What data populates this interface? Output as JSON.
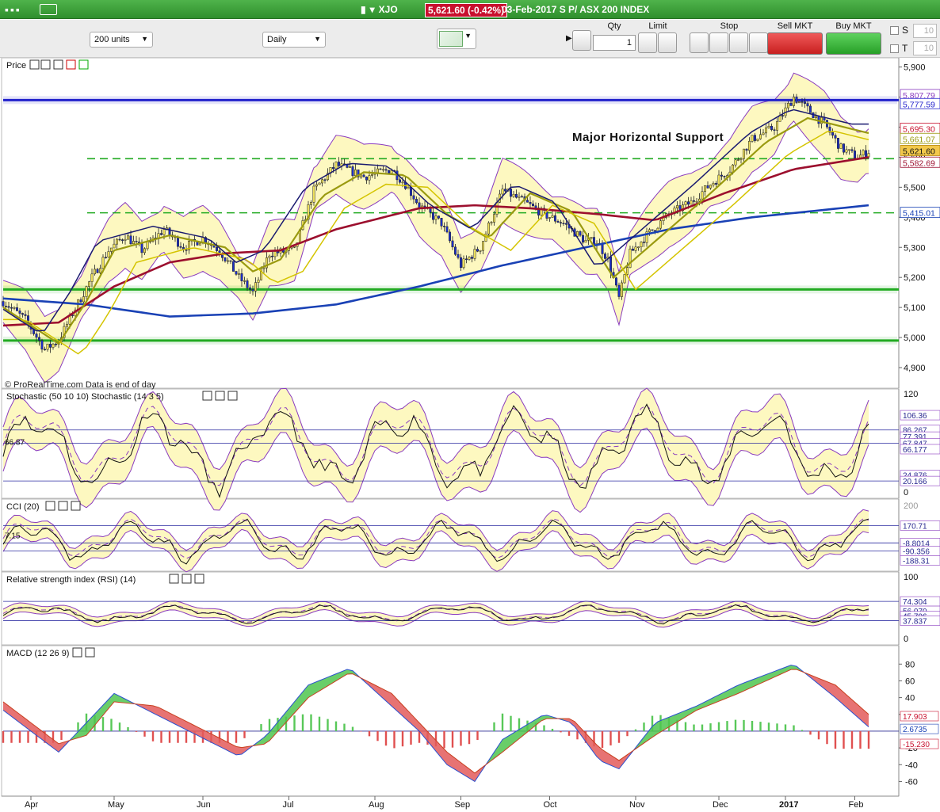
{
  "window": {
    "symbol": "XJO",
    "price_change": "5,621.60 (-0.42%)",
    "info": "03-Feb-2017 S P/ ASX 200 INDEX"
  },
  "toolbar": {
    "units_select": "200 units",
    "period_select": "Daily",
    "qty_label": "Qty",
    "qty_value": "1",
    "limit_label": "Limit",
    "stop_label": "Stop",
    "sell_label": "Sell MKT",
    "buy_label": "Buy MKT",
    "s_label": "S",
    "t_label": "T",
    "s_value": "10",
    "t_value": "10"
  },
  "colors": {
    "band_fill": "#fdf8c0",
    "band_line": "#8a3bbf",
    "up_candle": "#f2e35c",
    "down_candle": "#1c2fc9",
    "ma_olive": "#9a9a10",
    "ma_red": "#9c0f2e",
    "ma_blue": "#1941b5",
    "support_green": "#22aa22",
    "resistance_blue": "#2222cc"
  },
  "chart_data": [
    {
      "type": "candlestick",
      "panel": "Price",
      "title": "Price",
      "watermark": "© ProRealTime.com  Data is end of day",
      "annotation": "Major Horizontal Support",
      "ylim": [
        4850,
        5920
      ],
      "yticks": [
        "5,900",
        "5,800",
        "5,700",
        "5,600",
        "5,500",
        "5,400",
        "5,300",
        "5,200",
        "5,100",
        "5,000",
        "4,900"
      ],
      "x_labels": [
        "Apr",
        "May",
        "Jun",
        "Jul",
        "Aug",
        "Sep",
        "Oct",
        "Nov",
        "Dec",
        "2017",
        "Feb"
      ],
      "close_path": [
        [
          0,
          5120
        ],
        [
          8,
          5060
        ],
        [
          15,
          4960
        ],
        [
          20,
          4990
        ],
        [
          25,
          5080
        ],
        [
          32,
          5200
        ],
        [
          38,
          5290
        ],
        [
          44,
          5340
        ],
        [
          50,
          5290
        ],
        [
          58,
          5360
        ],
        [
          65,
          5300
        ],
        [
          72,
          5330
        ],
        [
          78,
          5290
        ],
        [
          85,
          5200
        ],
        [
          90,
          5150
        ],
        [
          96,
          5280
        ],
        [
          105,
          5290
        ],
        [
          112,
          5490
        ],
        [
          120,
          5575
        ],
        [
          130,
          5535
        ],
        [
          140,
          5560
        ],
        [
          145,
          5510
        ],
        [
          150,
          5440
        ],
        [
          158,
          5380
        ],
        [
          165,
          5240
        ],
        [
          172,
          5300
        ],
        [
          180,
          5490
        ],
        [
          188,
          5450
        ],
        [
          195,
          5410
        ],
        [
          202,
          5380
        ],
        [
          210,
          5320
        ],
        [
          214,
          5320
        ],
        [
          218,
          5260
        ],
        [
          222,
          5130
        ],
        [
          226,
          5280
        ],
        [
          232,
          5340
        ],
        [
          240,
          5410
        ],
        [
          248,
          5450
        ],
        [
          255,
          5510
        ],
        [
          262,
          5560
        ],
        [
          270,
          5660
        ],
        [
          278,
          5700
        ],
        [
          285,
          5800
        ],
        [
          290,
          5760
        ],
        [
          296,
          5710
        ],
        [
          302,
          5630
        ],
        [
          308,
          5600
        ],
        [
          312,
          5620
        ]
      ],
      "series": [
        {
          "name": "",
          "color": "#1941b5",
          "points": [
            [
              0,
              5130
            ],
            [
              30,
              5110
            ],
            [
              60,
              5070
            ],
            [
              90,
              5080
            ],
            [
              120,
              5110
            ],
            [
              150,
              5170
            ],
            [
              180,
              5240
            ],
            [
              210,
              5300
            ],
            [
              240,
              5360
            ],
            [
              270,
              5400
            ],
            [
              312,
              5440
            ]
          ]
        },
        {
          "name": "",
          "color": "#9c0f2e",
          "points": [
            [
              0,
              5040
            ],
            [
              20,
              5050
            ],
            [
              40,
              5170
            ],
            [
              60,
              5250
            ],
            [
              80,
              5280
            ],
            [
              100,
              5290
            ],
            [
              120,
              5360
            ],
            [
              150,
              5430
            ],
            [
              170,
              5440
            ],
            [
              190,
              5430
            ],
            [
              215,
              5410
            ],
            [
              235,
              5390
            ],
            [
              260,
              5480
            ],
            [
              285,
              5560
            ],
            [
              312,
              5600
            ]
          ]
        },
        {
          "name": "",
          "color": "#9a9a10",
          "points": [
            [
              0,
              5100
            ],
            [
              10,
              5040
            ],
            [
              20,
              4980
            ],
            [
              30,
              5120
            ],
            [
              40,
              5290
            ],
            [
              60,
              5340
            ],
            [
              80,
              5300
            ],
            [
              90,
              5220
            ],
            [
              100,
              5260
            ],
            [
              115,
              5470
            ],
            [
              130,
              5550
            ],
            [
              145,
              5540
            ],
            [
              160,
              5410
            ],
            [
              175,
              5330
            ],
            [
              190,
              5480
            ],
            [
              205,
              5420
            ],
            [
              220,
              5200
            ],
            [
              235,
              5320
            ],
            [
              255,
              5480
            ],
            [
              275,
              5650
            ],
            [
              290,
              5730
            ],
            [
              312,
              5680
            ]
          ]
        }
      ],
      "levels": [
        {
          "kind": "solid",
          "color": "#2222cc",
          "value": 5790
        },
        {
          "kind": "dashed",
          "color": "#22aa22",
          "value": 5595
        },
        {
          "kind": "dashed",
          "color": "#22aa22",
          "value": 5415
        },
        {
          "kind": "solid",
          "color": "#22aa22",
          "value": 5160
        },
        {
          "kind": "solid",
          "color": "#22aa22",
          "value": 4990
        }
      ],
      "price_tags": [
        {
          "label": "5,807.79",
          "value": 5807,
          "color": "#8a3bbf"
        },
        {
          "label": "5,777.59",
          "value": 5777,
          "color": "#2222cc"
        },
        {
          "label": "5,695.30",
          "value": 5695,
          "color": "#c8102e"
        },
        {
          "label": "5,661.07",
          "value": 5661,
          "color": "#9a9a10"
        },
        {
          "label": "5,621.60",
          "value": 5621,
          "color": "#b8860b"
        },
        {
          "label": "5,582.69",
          "value": 5582,
          "color": "#9c0f2e"
        },
        {
          "label": "5,415.01",
          "value": 5415,
          "color": "#1941b5"
        }
      ]
    },
    {
      "type": "line",
      "panel": "Stochastic",
      "title": "Stochastic (50 10 10) Stochastic (14 3 5)",
      "ylim": [
        0,
        120
      ],
      "yticks": [
        "120",
        "0"
      ],
      "left_label": "66.87",
      "price_tags": [
        {
          "label": "106.36",
          "value": 106
        },
        {
          "label": "86.267",
          "value": 86
        },
        {
          "label": "77.391",
          "value": 77
        },
        {
          "label": "67.847",
          "value": 68
        },
        {
          "label": "66.177",
          "value": 60
        },
        {
          "label": "24.876",
          "value": 25
        },
        {
          "label": "20.166",
          "value": 17
        }
      ]
    },
    {
      "type": "line",
      "panel": "CCI",
      "title": "CCI (20)",
      "ylim": [
        -250,
        280
      ],
      "yticks": [
        "200"
      ],
      "left_label": "7.15",
      "price_tags": [
        {
          "label": "170.71",
          "value": 170
        },
        {
          "label": "-8.8014",
          "value": -8
        },
        {
          "label": "-90.356",
          "value": -90
        },
        {
          "label": "-188.31",
          "value": -188
        }
      ]
    },
    {
      "type": "line",
      "panel": "RSI",
      "title": "Relative strength index (RSI) (14)",
      "ylim": [
        0,
        100
      ],
      "yticks": [
        "100",
        "0"
      ],
      "price_tags": [
        {
          "label": "74.304",
          "value": 74
        },
        {
          "label": "56.070",
          "value": 56
        },
        {
          "label": "45.796",
          "value": 46
        },
        {
          "label": "37.837",
          "value": 37
        }
      ]
    },
    {
      "type": "bar",
      "panel": "MACD",
      "title": "MACD (12 26 9)",
      "ylim": [
        -70,
        85
      ],
      "yticks": [
        "80",
        "60",
        "40",
        "20",
        "-20",
        "-40",
        "-60"
      ],
      "price_tags": [
        {
          "label": "17.903",
          "value": 17.9,
          "color": "#c8102e"
        },
        {
          "label": "2.6735",
          "value": 2.67,
          "color": "#1941b5"
        },
        {
          "label": "-15.230",
          "value": -15.2,
          "color": "#c8102e"
        }
      ],
      "macd": [
        [
          0,
          25
        ],
        [
          10,
          0
        ],
        [
          20,
          -25
        ],
        [
          30,
          10
        ],
        [
          40,
          45
        ],
        [
          55,
          20
        ],
        [
          70,
          -5
        ],
        [
          85,
          -30
        ],
        [
          95,
          -5
        ],
        [
          110,
          55
        ],
        [
          125,
          75
        ],
        [
          140,
          30
        ],
        [
          150,
          0
        ],
        [
          160,
          -40
        ],
        [
          170,
          -60
        ],
        [
          180,
          -10
        ],
        [
          195,
          20
        ],
        [
          205,
          10
        ],
        [
          215,
          -35
        ],
        [
          222,
          -45
        ],
        [
          235,
          10
        ],
        [
          250,
          30
        ],
        [
          265,
          55
        ],
        [
          285,
          80
        ],
        [
          300,
          40
        ],
        [
          312,
          5
        ]
      ],
      "signal": [
        [
          0,
          35
        ],
        [
          10,
          10
        ],
        [
          20,
          -15
        ],
        [
          30,
          -5
        ],
        [
          40,
          35
        ],
        [
          55,
          30
        ],
        [
          70,
          5
        ],
        [
          85,
          -20
        ],
        [
          95,
          -15
        ],
        [
          110,
          40
        ],
        [
          125,
          70
        ],
        [
          140,
          45
        ],
        [
          150,
          10
        ],
        [
          160,
          -25
        ],
        [
          170,
          -50
        ],
        [
          180,
          -25
        ],
        [
          195,
          15
        ],
        [
          205,
          15
        ],
        [
          215,
          -20
        ],
        [
          222,
          -35
        ],
        [
          235,
          -5
        ],
        [
          250,
          25
        ],
        [
          265,
          45
        ],
        [
          285,
          75
        ],
        [
          300,
          55
        ],
        [
          312,
          20
        ]
      ]
    }
  ]
}
